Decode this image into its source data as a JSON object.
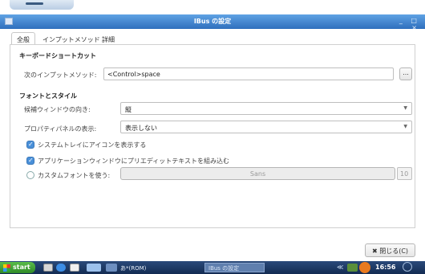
{
  "window": {
    "title": "IBus の設定",
    "controls": "_ □ ×"
  },
  "tabs": [
    {
      "label": "全般"
    },
    {
      "label": "インプットメソッド"
    },
    {
      "label": "詳細"
    }
  ],
  "shortcut_section": {
    "header": "キーボードショートカット",
    "next_im_label": "次のインプットメソッド:",
    "next_im_value": "<Control>space",
    "browse_label": "..."
  },
  "font_style_section": {
    "header": "フォントとスタイル",
    "candidate_orientation_label": "候補ウィンドウの向き:",
    "candidate_orientation_value": "縦",
    "property_panel_label": "プロパティパネルの表示:",
    "property_panel_value": "表示しない",
    "tray_icon_label": "システムトレイにアイコンを表示する",
    "tray_icon_checked": true,
    "preedit_label": "アプリケーションウィンドウにプリエディットテキストを組み込む",
    "preedit_checked": true,
    "custom_font_label": "カスタムフォントを使う:",
    "custom_font_checked": false,
    "font_name": "Sans",
    "font_size": "10"
  },
  "close_button": {
    "label": "閉じる(C)"
  },
  "taskbar": {
    "start_label": "start",
    "input_indicator": "あ*(ROM)",
    "task_window_label": "IBus の設定",
    "tray_text": "≪",
    "clock": "16:56"
  },
  "colors": {
    "titlebar": "#2f6fbd",
    "checkbox_on": "#4a90d9",
    "taskbar": "#132b52",
    "start": "#2f8a27"
  }
}
